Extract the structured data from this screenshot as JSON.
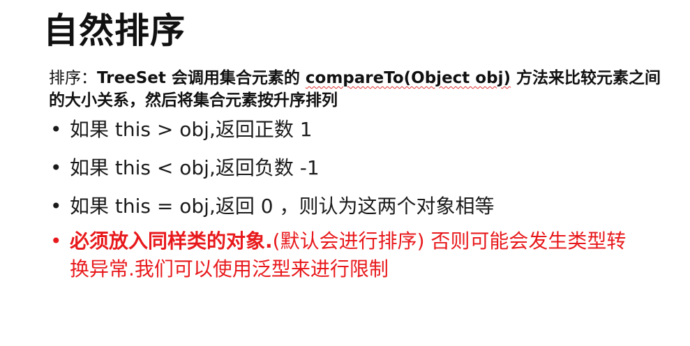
{
  "title": "自然排序",
  "intro": {
    "lead": "排序：",
    "part1": "TreeSet 会调用集合元素的 ",
    "method": "compareTo(Object obj)",
    "part2": " 方法来比较元素之间的大小关系，然后将集合元素按升序排列"
  },
  "bullet_glyph": "•",
  "bullets": [
    {
      "text": "如果 this > obj,返回正数 1"
    },
    {
      "text": "如果 this < obj,返回负数 -1"
    },
    {
      "text": "如果 this = obj,返回 0 ，则认为这两个对象相等"
    }
  ],
  "warning": {
    "bold": "必须放入同样类的对象.",
    "rest": "(默认会进行排序) 否则可能会发生类型转换异常.我们可以使用泛型来进行限制"
  },
  "colors": {
    "text": "#111111",
    "warning": "#e8191c",
    "spell_underline": "#e03030"
  }
}
